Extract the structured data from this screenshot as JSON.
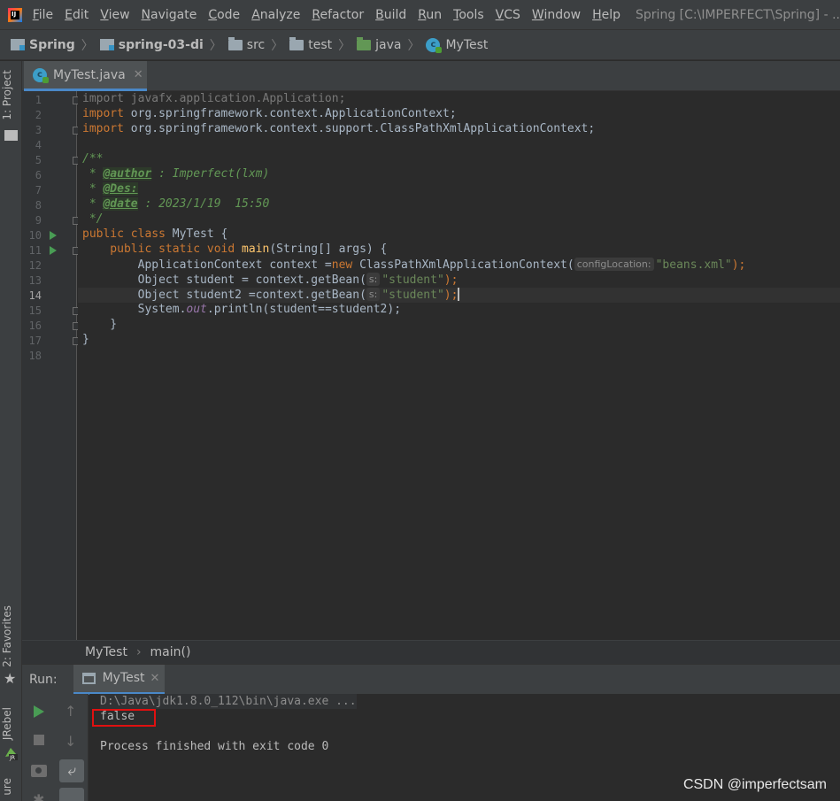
{
  "menu": {
    "items": [
      "File",
      "Edit",
      "View",
      "Navigate",
      "Code",
      "Analyze",
      "Refactor",
      "Build",
      "Run",
      "Tools",
      "VCS",
      "Window",
      "Help"
    ],
    "window_title": "Spring [C:\\IMPERFECT\\Spring] - ..."
  },
  "navbar": {
    "crumbs": [
      "Spring",
      "spring-03-di",
      "src",
      "test",
      "java",
      "MyTest"
    ]
  },
  "leftstrip": {
    "project_tab": "1: Project",
    "favorites_tab": "2: Favorites",
    "jrebel_tab": "JRebel",
    "structure_tab": "ure"
  },
  "editor": {
    "tab_label": "MyTest.java",
    "line_numbers": [
      "1",
      "2",
      "3",
      "4",
      "5",
      "6",
      "7",
      "8",
      "9",
      "10",
      "11",
      "12",
      "13",
      "14",
      "15",
      "16",
      "17",
      "18"
    ],
    "current_line": 14,
    "breadcrumb": [
      "MyTest",
      "main()"
    ],
    "code": {
      "l1": "import javafx.application.Application;",
      "l2_kw": "import",
      "l2_rest": " org.springframework.context.ApplicationContext;",
      "l3_kw": "import",
      "l3_rest": " org.springframework.context.support.ClassPathXmlApplicationContext;",
      "l5": "/**",
      "l6_pre": " * ",
      "l6_tag": "@author",
      "l6_rest": " : Imperfect(lxm)",
      "l7_pre": " * ",
      "l7_tag": "@Des:",
      "l8_pre": " * ",
      "l8_tag": "@date",
      "l8_rest": " : 2023/1/19  15:50",
      "l9": " */",
      "l10_kw": "public class",
      "l10_rest": " MyTest {",
      "l11_kw": "    public static void",
      "l11_fn": "main",
      "l11_rest": "(String[] args) {",
      "l12_a": "        ApplicationContext context =",
      "l12_new": "new",
      "l12_b": " ClassPathXmlApplicationContext(",
      "l12_hint": "configLocation:",
      "l12_str": "\"beans.xml\"",
      "l12_end": ");",
      "l13_a": "        Object student = context.getBean(",
      "l13_hint": "s:",
      "l13_str": "\"student\"",
      "l13_end": ");",
      "l14_a": "        Object student2 =context.getBean(",
      "l14_hint": "s:",
      "l14_str": "\"student\"",
      "l14_end": ");",
      "l15_a": "        System.",
      "l15_out": "out",
      "l15_b": ".println(student==student2);",
      "l16": "    }",
      "l17": "}"
    }
  },
  "run": {
    "title": "Run:",
    "tab_label": "MyTest",
    "command": "D:\\Java\\jdk1.8.0_112\\bin\\java.exe ...",
    "output": "false",
    "finished": "Process finished with exit code 0"
  },
  "watermark": "CSDN @imperfectsam",
  "colors": {
    "keyword": "#cc7832",
    "string": "#6a8759",
    "comment": "#629755",
    "accent": "#4a88c7",
    "highlight_box": "#e01010"
  }
}
